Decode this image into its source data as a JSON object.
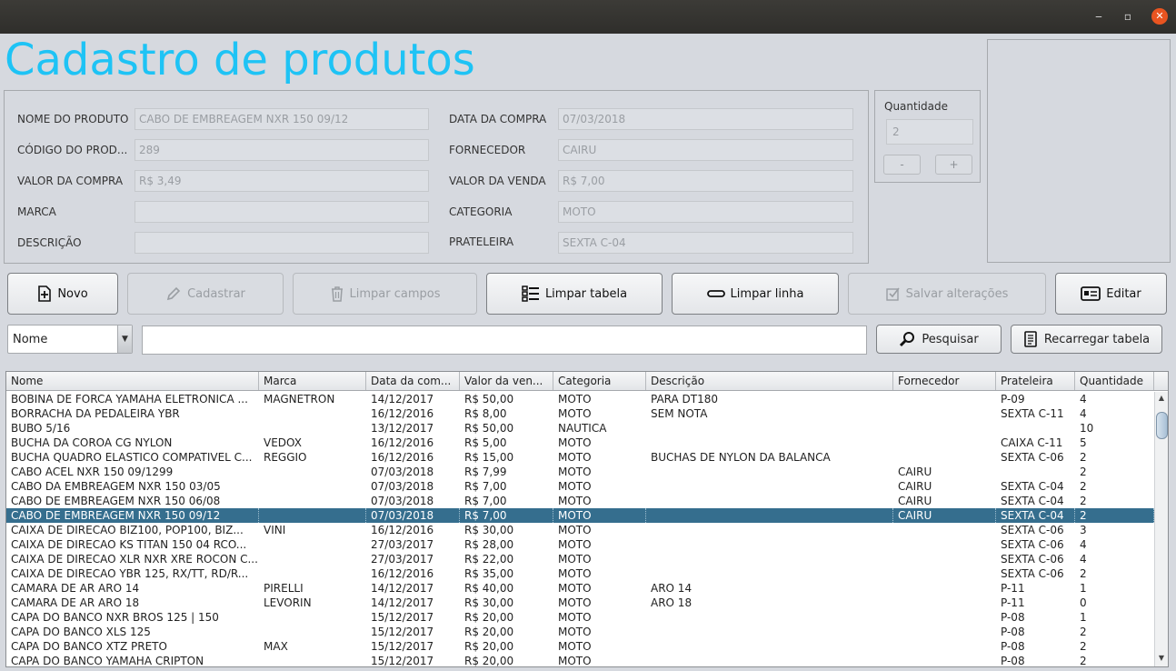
{
  "window": {
    "min_icon": "minimize-icon",
    "max_icon": "maximize-icon",
    "close_icon": "close-icon"
  },
  "title": "Cadastro de produtos",
  "form": {
    "nome_label": "NOME DO PRODUTO",
    "nome_value": "CABO DE EMBREAGEM NXR 150 09/12",
    "codigo_label": "CÓDIGO DO PROD...",
    "codigo_value": "289",
    "valor_compra_label": "VALOR DA COMPRA",
    "valor_compra_value": "R$ 3,49",
    "marca_label": "MARCA",
    "marca_value": "",
    "descricao_label": "DESCRIÇÃO",
    "descricao_value": "",
    "data_label": "DATA DA COMPRA",
    "data_value": "07/03/2018",
    "fornecedor_label": "FORNECEDOR",
    "fornecedor_value": "CAIRU",
    "valor_venda_label": "VALOR DA VENDA",
    "valor_venda_value": "R$ 7,00",
    "categoria_label": "CATEGORIA",
    "categoria_value": "MOTO",
    "prateleira_label": "PRATELEIRA",
    "prateleira_value": "SEXTA C-04"
  },
  "quantity": {
    "label": "Quantidade",
    "value": "2",
    "minus": "-",
    "plus": "+"
  },
  "toolbar": {
    "novo": "Novo",
    "cadastrar": "Cadastrar",
    "limpar_campos": "Limpar campos",
    "limpar_tabela": "Limpar tabela",
    "limpar_linha": "Limpar linha",
    "salvar": "Salvar alterações",
    "editar": "Editar"
  },
  "search": {
    "field_selected": "Nome",
    "query": "",
    "pesquisar": "Pesquisar",
    "recarregar": "Recarregar tabela"
  },
  "table": {
    "columns": [
      "Nome",
      "Marca",
      "Data da com...",
      "Valor da ven...",
      "Categoria",
      "Descrição",
      "Fornecedor",
      "Prateleira",
      "Quantidade"
    ],
    "selected_index": 8,
    "rows": [
      [
        "BOBINA DE FORCA YAMAHA ELETRONICA ...",
        "MAGNETRON",
        "14/12/2017",
        "R$ 50,00",
        "MOTO",
        "PARA DT180",
        "",
        "P-09",
        "4"
      ],
      [
        "BORRACHA DA PEDALEIRA YBR",
        "",
        "16/12/2016",
        "R$ 8,00",
        "MOTO",
        "SEM NOTA",
        "",
        "SEXTA C-11",
        "4"
      ],
      [
        "BUBO 5/16",
        "",
        "13/12/2017",
        "R$ 50,00",
        "NAUTICA",
        "",
        "",
        "",
        "10"
      ],
      [
        "BUCHA DA COROA CG NYLON",
        "VEDOX",
        "16/12/2016",
        "R$ 5,00",
        "MOTO",
        "",
        "",
        "CAIXA C-11",
        "5"
      ],
      [
        "BUCHA QUADRO ELASTICO COMPATIVEL C...",
        "REGGIO",
        "16/12/2016",
        "R$ 15,00",
        "MOTO",
        "BUCHAS DE NYLON DA BALANCA",
        "",
        "SEXTA C-06",
        "2"
      ],
      [
        "CABO ACEL NXR 150 09/1299",
        "",
        "07/03/2018",
        "R$ 7,99",
        "MOTO",
        "",
        "CAIRU",
        "",
        "2"
      ],
      [
        "CABO DA EMBREAGEM NXR 150 03/05",
        "",
        "07/03/2018",
        "R$ 7,00",
        "MOTO",
        "",
        "CAIRU",
        "SEXTA C-04",
        "2"
      ],
      [
        "CABO DE EMBREAGEM NXR 150 06/08",
        "",
        "07/03/2018",
        "R$ 7,00",
        "MOTO",
        "",
        "CAIRU",
        "SEXTA C-04",
        "2"
      ],
      [
        "CABO DE EMBREAGEM NXR 150 09/12",
        "",
        "07/03/2018",
        "R$ 7,00",
        "MOTO",
        "",
        "CAIRU",
        "SEXTA C-04",
        "2"
      ],
      [
        "CAIXA DE DIRECAO BIZ100, POP100, BIZ...",
        "VINI",
        "16/12/2016",
        "R$ 30,00",
        "MOTO",
        "",
        "",
        "SEXTA C-06",
        "3"
      ],
      [
        "CAIXA DE DIRECAO KS TITAN 150 04 RCO...",
        "",
        "27/03/2017",
        "R$ 28,00",
        "MOTO",
        "",
        "",
        "SEXTA C-06",
        "4"
      ],
      [
        "CAIXA DE DIRECAO XLR NXR XRE ROCON C...",
        "",
        "27/03/2017",
        "R$ 22,00",
        "MOTO",
        "",
        "",
        "SEXTA C-06",
        "4"
      ],
      [
        "CAIXA DE DIRECAO YBR 125, RX/TT, RD/R...",
        "",
        "16/12/2016",
        "R$ 35,00",
        "MOTO",
        "",
        "",
        "SEXTA  C-06",
        "2"
      ],
      [
        "CAMARA DE AR ARO 14",
        "PIRELLI",
        "14/12/2017",
        "R$ 40,00",
        "MOTO",
        "ARO 14",
        "",
        "P-11",
        "1"
      ],
      [
        "CAMARA DE AR ARO 18",
        "LEVORIN",
        "14/12/2017",
        "R$ 30,00",
        "MOTO",
        "ARO 18",
        "",
        "P-11",
        "0"
      ],
      [
        "CAPA DO BANCO NXR BROS 125 | 150",
        "",
        "15/12/2017",
        "R$ 20,00",
        "MOTO",
        "",
        "",
        "P-08",
        "1"
      ],
      [
        "CAPA DO BANCO XLS 125",
        "",
        "15/12/2017",
        "R$ 20,00",
        "MOTO",
        "",
        "",
        "P-08",
        "2"
      ],
      [
        "CAPA DO BANCO XTZ PRETO",
        "MAX",
        "15/12/2017",
        "R$ 20,00",
        "MOTO",
        "",
        "",
        "P-08",
        "2"
      ],
      [
        "CAPA DO BANCO YAMAHA CRIPTON",
        "",
        "15/12/2017",
        "R$ 20,00",
        "MOTO",
        "",
        "",
        "P-08",
        "2"
      ]
    ]
  }
}
